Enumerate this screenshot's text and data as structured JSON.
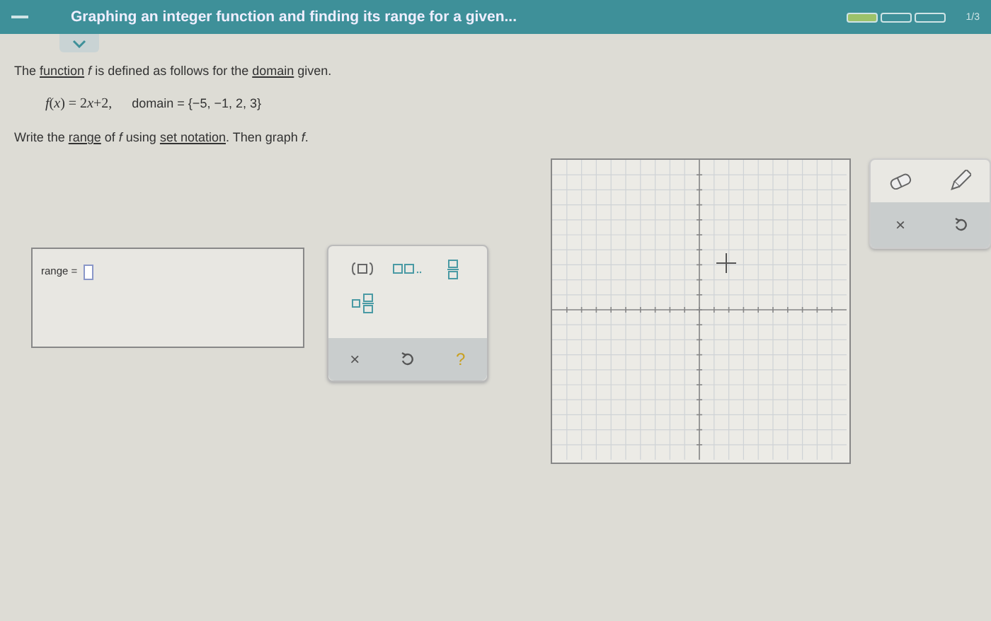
{
  "header": {
    "title": "Graphing an integer function and finding its range for a given...",
    "progress": [
      {
        "done": true
      },
      {
        "done": false
      },
      {
        "done": false
      }
    ],
    "progress_label": "1/3"
  },
  "problem": {
    "intro": [
      {
        "kind": "text",
        "text": "The "
      },
      {
        "kind": "link",
        "text": "function"
      },
      {
        "kind": "var",
        "text": " f"
      },
      {
        "kind": "text",
        "text": " is defined as follows for the "
      },
      {
        "kind": "link",
        "text": "domain"
      },
      {
        "kind": "text",
        "text": " given."
      }
    ],
    "equation": [
      {
        "kind": "var",
        "text": "f"
      },
      {
        "kind": "text",
        "text": "("
      },
      {
        "kind": "var",
        "text": "x"
      },
      {
        "kind": "text",
        "text": ") = 2"
      },
      {
        "kind": "var",
        "text": "x"
      },
      {
        "kind": "text",
        "text": "+2,"
      }
    ],
    "domain": "domain = {−5, −1, 2, 3}",
    "instruction": [
      {
        "kind": "text",
        "text": "Write the "
      },
      {
        "kind": "link",
        "text": "range"
      },
      {
        "kind": "text",
        "text": " of "
      },
      {
        "kind": "var",
        "text": "f"
      },
      {
        "kind": "text",
        "text": " using "
      },
      {
        "kind": "link",
        "text": "set notation"
      },
      {
        "kind": "text",
        "text": ". Then graph "
      },
      {
        "kind": "var",
        "text": "f"
      },
      {
        "kind": "text",
        "text": "."
      }
    ]
  },
  "answer": {
    "label": "range ="
  },
  "keypad": {
    "keys": [
      {
        "kind": "set"
      },
      {
        "kind": "list"
      },
      {
        "kind": "fraction"
      },
      {
        "kind": "mixed"
      }
    ],
    "actions": [
      {
        "kind": "clear",
        "label": "×"
      },
      {
        "kind": "undo"
      },
      {
        "kind": "help",
        "label": "?"
      }
    ]
  },
  "graph_tools": {
    "tools": [
      {
        "kind": "eraser"
      },
      {
        "kind": "pencil"
      }
    ],
    "actions": [
      {
        "kind": "clear",
        "label": "×"
      },
      {
        "kind": "undo"
      }
    ]
  }
}
